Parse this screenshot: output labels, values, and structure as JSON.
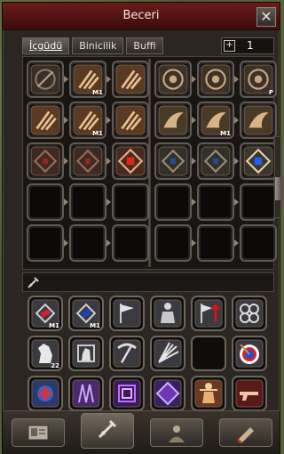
{
  "window": {
    "title": "Beceri",
    "close_glyph": "✕"
  },
  "tabs": [
    "İçgüdü",
    "Binicilik",
    "Buffi"
  ],
  "page": {
    "plus": "+",
    "number": "1"
  },
  "skill_tree": {
    "left": [
      [
        {
          "icon": "slash-skill-icon",
          "level": ""
        },
        {
          "icon": "claw-skill-icon",
          "level": "M1"
        },
        {
          "icon": "claw-skill-icon",
          "level": ""
        }
      ],
      [
        {
          "icon": "claw-skill-icon",
          "level": ""
        },
        {
          "icon": "claw-skill-icon",
          "level": "M1"
        },
        {
          "icon": "claw-skill-icon",
          "level": ""
        }
      ],
      [
        {
          "icon": "rune-red-icon",
          "level": ""
        },
        {
          "icon": "rune-red-icon",
          "level": ""
        },
        {
          "icon": "rune-red-active-icon",
          "level": ""
        }
      ],
      [
        {
          "icon": "empty-slot",
          "level": ""
        },
        {
          "icon": "empty-slot",
          "level": ""
        },
        {
          "icon": "empty-slot",
          "level": ""
        }
      ],
      [
        {
          "icon": "empty-slot",
          "level": ""
        },
        {
          "icon": "empty-slot",
          "level": ""
        },
        {
          "icon": "empty-slot",
          "level": ""
        }
      ]
    ],
    "right": [
      [
        {
          "icon": "target-skill-icon",
          "level": ""
        },
        {
          "icon": "target-skill-icon",
          "level": ""
        },
        {
          "icon": "target-skill-icon",
          "level": "P"
        }
      ],
      [
        {
          "icon": "wing-skill-icon",
          "level": ""
        },
        {
          "icon": "wing-skill-icon",
          "level": "M1"
        },
        {
          "icon": "wing-skill-icon",
          "level": ""
        }
      ],
      [
        {
          "icon": "rune-blue-icon",
          "level": ""
        },
        {
          "icon": "rune-blue-icon",
          "level": ""
        },
        {
          "icon": "rune-blue-active-icon",
          "level": ""
        }
      ],
      [
        {
          "icon": "empty-slot",
          "level": ""
        },
        {
          "icon": "empty-slot",
          "level": ""
        },
        {
          "icon": "empty-slot",
          "level": ""
        }
      ],
      [
        {
          "icon": "empty-slot",
          "level": ""
        },
        {
          "icon": "empty-slot",
          "level": ""
        },
        {
          "icon": "empty-slot",
          "level": ""
        }
      ]
    ]
  },
  "info_bar": {
    "icon": "sword-icon"
  },
  "common_skills": [
    [
      {
        "icon": "scroll-red-icon",
        "level": "M1"
      },
      {
        "icon": "scroll-blue-icon",
        "level": "M1"
      },
      {
        "icon": "flag-icon",
        "level": ""
      },
      {
        "icon": "statue-icon",
        "level": ""
      },
      {
        "icon": "flag-up-icon",
        "level": ""
      },
      {
        "icon": "knot-icon",
        "level": ""
      }
    ],
    [
      {
        "icon": "horse-icon",
        "level": "22"
      },
      {
        "icon": "horse-mount-icon",
        "level": ""
      },
      {
        "icon": "pickaxe-icon",
        "level": ""
      },
      {
        "icon": "fan-icon",
        "level": ""
      },
      {
        "icon": "empty-slot",
        "level": ""
      },
      {
        "icon": "target-arrow-icon",
        "level": ""
      }
    ],
    [
      {
        "icon": "holy-cross-icon",
        "level": ""
      },
      {
        "icon": "crystal-purple-icon",
        "level": ""
      },
      {
        "icon": "square-purple-icon",
        "level": ""
      },
      {
        "icon": "diamond-purple-icon",
        "level": ""
      },
      {
        "icon": "warrior-icon",
        "level": ""
      },
      {
        "icon": "gun-icon",
        "level": ""
      }
    ]
  ],
  "footer_tabs": [
    "character-card-icon",
    "sword-tab-icon",
    "character-tab-icon",
    "scroll-tab-icon"
  ],
  "colors": {
    "title_bg": "#4d1412",
    "accent": "#c8a27a"
  }
}
